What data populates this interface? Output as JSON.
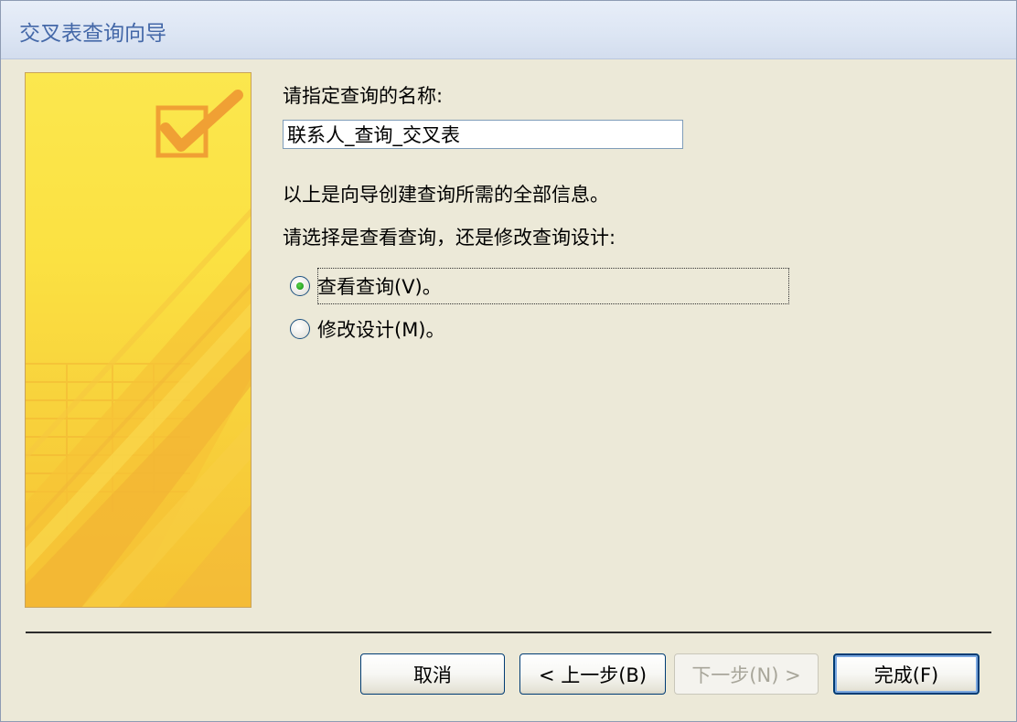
{
  "window": {
    "title": "交叉表查询向导"
  },
  "form": {
    "name_prompt": "请指定查询的名称:",
    "name_value": "联系人_查询_交叉表",
    "info_text": "以上是向导创建查询所需的全部信息。",
    "choice_prompt": "请选择是查看查询，还是修改查询设计:"
  },
  "options": [
    {
      "label": "查看查询(V)。",
      "selected": true
    },
    {
      "label": "修改设计(M)。",
      "selected": false
    }
  ],
  "buttons": {
    "cancel": "取消",
    "back": "< 上一步(B)",
    "next": "下一步(N) >",
    "finish": "完成(F)"
  },
  "colors": {
    "title_text": "#4468a8",
    "banner_yellow": "#fbe142",
    "banner_orange": "#f3a838",
    "radio_selected": "#21a121"
  },
  "icons": {
    "banner_graphic": "checkbox-checkmark-icon"
  }
}
